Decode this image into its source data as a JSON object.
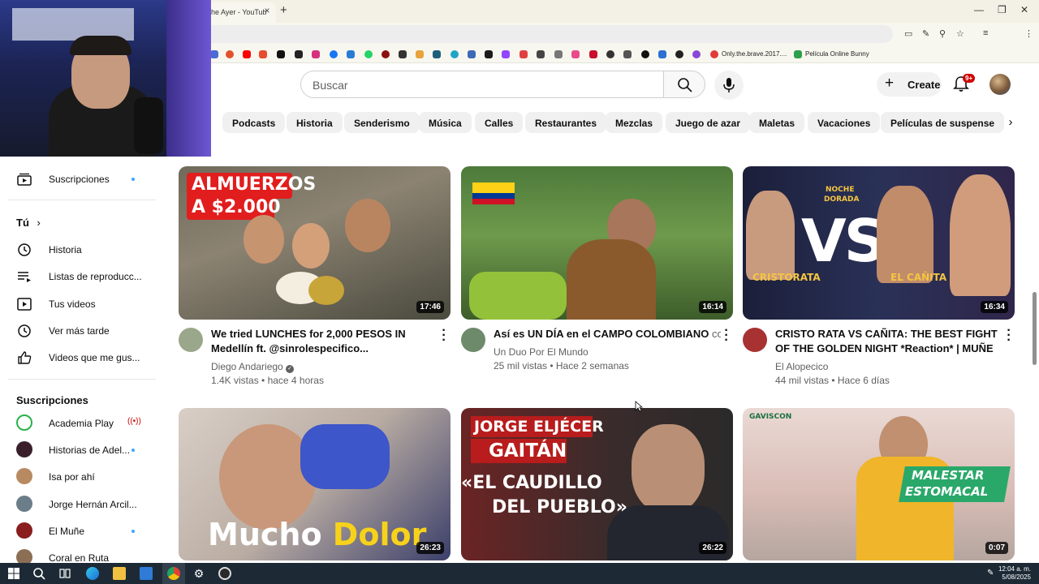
{
  "browser": {
    "active_tab_title": "he Ayer - YouTub",
    "tab_close": "×",
    "new_tab": "+",
    "bookmarks_text": [
      "Only.the.brave.2017....",
      "Película Online Bunny"
    ]
  },
  "header": {
    "search_placeholder": "Buscar",
    "create_label": "Create",
    "notifications_badge": "9+"
  },
  "chips": [
    "Podcasts",
    "Historia",
    "Senderismo",
    "Música",
    "Calles",
    "Restaurantes",
    "Mezclas",
    "Juego de azar",
    "Maletas",
    "Vacaciones",
    "Películas de suspense"
  ],
  "sidebar": {
    "subscriptions_item": "Suscripciones",
    "you_header": "Tú",
    "you_items": [
      "Historia",
      "Listas de reproducc...",
      "Tus videos",
      "Ver más tarde",
      "Videos que me gus..."
    ],
    "subs_header": "Suscripciones",
    "channels": [
      "Academia Play",
      "Historias de Adel...",
      "Isa por ahí",
      "Jorge Hernán Arcil...",
      "El Muñe",
      "Coral en Ruta"
    ]
  },
  "videos": [
    {
      "title": "We tried LUNCHES for 2,000 PESOS IN Medellín ft. @sinrolespecifico...",
      "channel": "Diego Andariego",
      "verified": true,
      "meta": "1.4K vistas • hace 4 horas",
      "duration": "17:46",
      "thumb_text": [
        "ALMUERZOS",
        "A $2.000"
      ]
    },
    {
      "title": "Así es UN DÍA en el CAMPO COLOMBIANO",
      "title_suffix": "co",
      "channel": "Un Duo Por El Mundo",
      "meta": "25 mil vistas • Hace 2 semanas",
      "duration": "16:14"
    },
    {
      "title": "CRISTO RATA VS CAÑITA: THE BEST FIGHT OF THE GOLDEN NIGHT *Reaction* | MUÑE",
      "channel": "El Alopecico",
      "meta": "44 mil vistas • Hace 6 días",
      "duration": "16:34",
      "thumb_text": [
        "NOCHE",
        "DORADA",
        "VS",
        "CRISTORATA",
        "EL CAÑITA"
      ]
    },
    {
      "duration": "26:23",
      "thumb_text": [
        "Mucho",
        "Dolor"
      ]
    },
    {
      "duration": "26:22",
      "thumb_text": [
        "JORGE ELJÉCER",
        "GAITÁN",
        "«EL CAUDILLO",
        "DEL PUEBLO»"
      ]
    },
    {
      "duration": "0:07",
      "thumb_text": [
        "GAVISCON",
        "MALESTAR",
        "ESTOMACAL"
      ]
    }
  ],
  "taskbar": {
    "time": "12:04 a. m.",
    "date": "5/08/2025"
  },
  "colors": {
    "accent_blue": "#3ea6ff",
    "badge_red": "#cc0000",
    "live_red": "#cc0000"
  }
}
